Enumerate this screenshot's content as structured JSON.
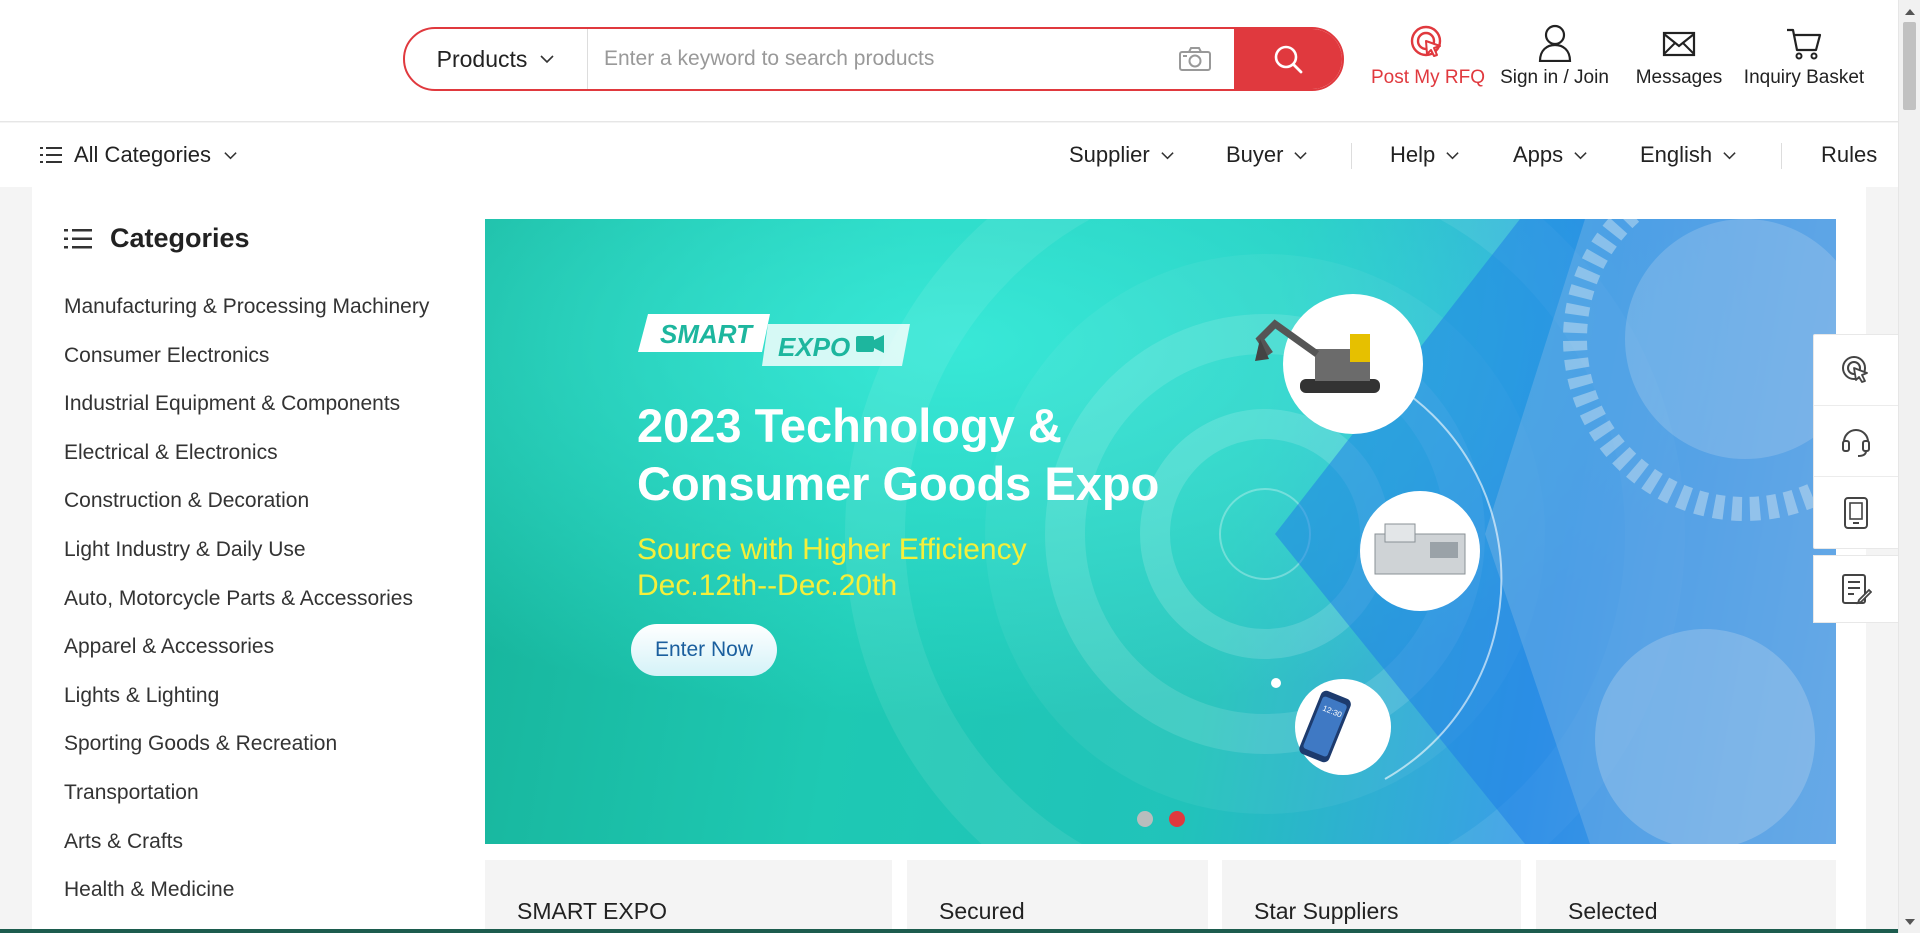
{
  "search": {
    "type_label": "Products",
    "placeholder": "Enter a keyword to search products"
  },
  "top_actions": {
    "rfq": "Post My RFQ",
    "sign_in": "Sign in / Join",
    "messages": "Messages",
    "basket": "Inquiry Basket"
  },
  "nav": {
    "all_categories": "All Categories",
    "supplier": "Supplier",
    "buyer": "Buyer",
    "help": "Help",
    "apps": "Apps",
    "language": "English",
    "rules": "Rules"
  },
  "categories": {
    "title": "Categories",
    "items": [
      "Manufacturing & Processing Machinery",
      "Consumer Electronics",
      "Industrial Equipment & Components",
      "Electrical & Electronics",
      "Construction & Decoration",
      "Light Industry & Daily Use",
      "Auto, Motorcycle Parts & Accessories",
      "Apparel & Accessories",
      "Lights & Lighting",
      "Sporting Goods & Recreation",
      "Transportation",
      "Arts & Crafts",
      "Health & Medicine"
    ]
  },
  "banner": {
    "logo_smart": "SMART",
    "logo_expo": "EXPO",
    "title_line1": "2023 Technology &",
    "title_line2": "Consumer Goods Expo",
    "subtitle": "Source with Higher Efficiency",
    "dates": "Dec.12th--Dec.20th",
    "cta": "Enter Now",
    "phone_time": "12:30",
    "active_slide": 2,
    "slide_count": 2
  },
  "cards": [
    "SMART EXPO",
    "Secured",
    "Star Suppliers",
    "Selected"
  ],
  "colors": {
    "accent": "#e0393e",
    "banner_teal": "#1ec9b3",
    "banner_blue": "#1f7fe6",
    "subtitle_yellow": "#f5ef3a"
  },
  "icons": {
    "rfq": "target-cursor-icon",
    "account": "user-icon",
    "messages": "envelope-icon",
    "basket": "cart-icon",
    "float": [
      "rfq-icon",
      "headset-icon",
      "tablet-icon",
      "notes-icon"
    ]
  }
}
